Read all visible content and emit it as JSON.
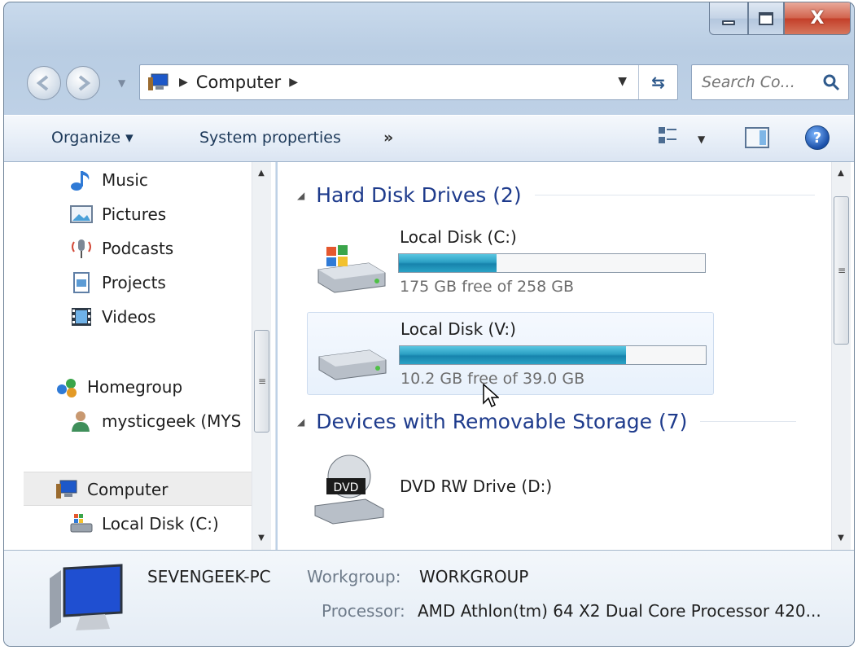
{
  "window": {
    "caption_buttons": {
      "minimize": "minimize",
      "maximize": "maximize",
      "close": "X"
    }
  },
  "address_bar": {
    "location": "Computer",
    "icon": "computer-icon"
  },
  "search": {
    "placeholder": "Search Co...",
    "icon": "search-icon"
  },
  "command_bar": {
    "organize_label": "Organize ▾",
    "system_properties_label": "System properties",
    "more_label": "»",
    "help_label": "?"
  },
  "nav_pane": {
    "items": [
      {
        "label": "Music",
        "icon": "music-icon"
      },
      {
        "label": "Pictures",
        "icon": "pictures-icon"
      },
      {
        "label": "Podcasts",
        "icon": "podcasts-icon"
      },
      {
        "label": "Projects",
        "icon": "document-icon"
      },
      {
        "label": "Videos",
        "icon": "videos-icon"
      },
      {
        "label": "Homegroup",
        "icon": "homegroup-icon"
      },
      {
        "label": "mysticgeek (MYS",
        "icon": "user-icon"
      },
      {
        "label": "Computer",
        "icon": "computer-icon",
        "selected": true
      },
      {
        "label": "Local Disk (C:)",
        "icon": "drive-icon"
      }
    ]
  },
  "content": {
    "groups": [
      {
        "title": "Hard Disk Drives (2)"
      },
      {
        "title": "Devices with Removable Storage (7)"
      }
    ],
    "drives": [
      {
        "name": "Local Disk (C:)",
        "info": "175 GB free of 258 GB",
        "used_fraction": 0.32,
        "icon": "windows-drive-icon"
      },
      {
        "name": "Local Disk (V:)",
        "info": "10.2 GB free of 39.0 GB",
        "used_fraction": 0.74,
        "icon": "hard-drive-icon"
      },
      {
        "name": "DVD RW Drive (D:)",
        "icon": "dvd-drive-icon",
        "badge": "DVD"
      }
    ]
  },
  "details": {
    "computer_name": "SEVENGEEK-PC",
    "workgroup_label": "Workgroup:",
    "workgroup": "WORKGROUP",
    "processor_label": "Processor:",
    "processor": "AMD Athlon(tm) 64 X2 Dual Core Processor 420..."
  }
}
